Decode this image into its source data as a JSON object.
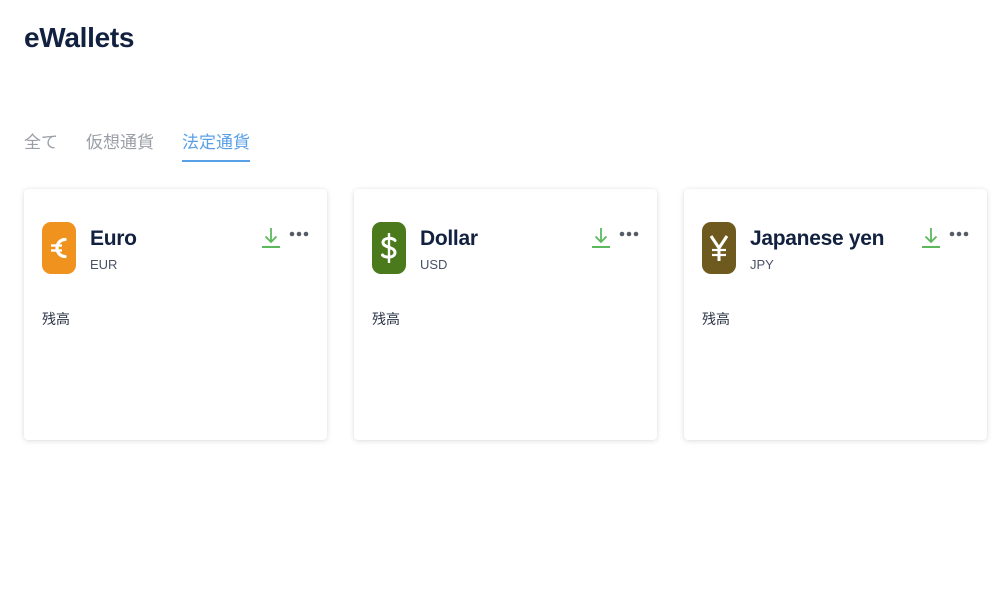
{
  "page": {
    "title": "eWallets"
  },
  "tabs": [
    {
      "label": "全て",
      "active": false
    },
    {
      "label": "仮想通貨",
      "active": false
    },
    {
      "label": "法定通貨",
      "active": true
    }
  ],
  "colors": {
    "accent": "#5aa0e6",
    "euro_icon": "#f0921e",
    "dollar_icon": "#4b7a1d",
    "yen_icon": "#6e5a1f",
    "download_icon": "#5cb85c"
  },
  "wallets": [
    {
      "name": "Euro",
      "code": "EUR",
      "icon": "euro-icon",
      "balance_label": "残高"
    },
    {
      "name": "Dollar",
      "code": "USD",
      "icon": "dollar-icon",
      "balance_label": "残高"
    },
    {
      "name": "Japanese yen",
      "code": "JPY",
      "icon": "yen-icon",
      "balance_label": "残高"
    }
  ]
}
